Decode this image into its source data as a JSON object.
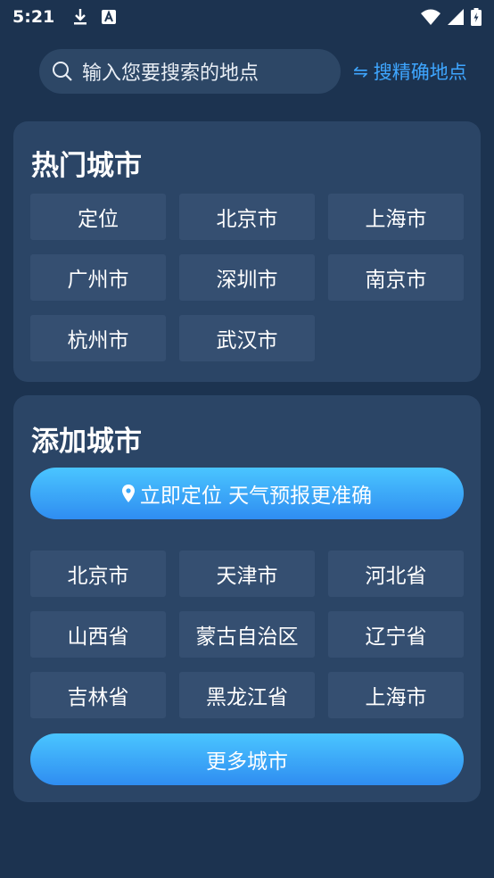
{
  "status_bar": {
    "time": "5:21"
  },
  "search": {
    "placeholder": "输入您要搜索的地点",
    "precise_link": "搜精确地点"
  },
  "hot_cities": {
    "title": "热门城市",
    "items": [
      "定位",
      "北京市",
      "上海市",
      "广州市",
      "深圳市",
      "南京市",
      "杭州市",
      "武汉市"
    ]
  },
  "add_city": {
    "title": "添加城市",
    "locate_button": "立即定位 天气预报更准确",
    "items": [
      "北京市",
      "天津市",
      "河北省",
      "山西省",
      "蒙古自治区",
      "辽宁省",
      "吉林省",
      "黑龙江省",
      "上海市"
    ],
    "more_button": "更多城市"
  },
  "colors": {
    "background": "#1c3350",
    "card": "#2b4566",
    "tile": "#354f71",
    "accent": "#3ea6ff"
  }
}
